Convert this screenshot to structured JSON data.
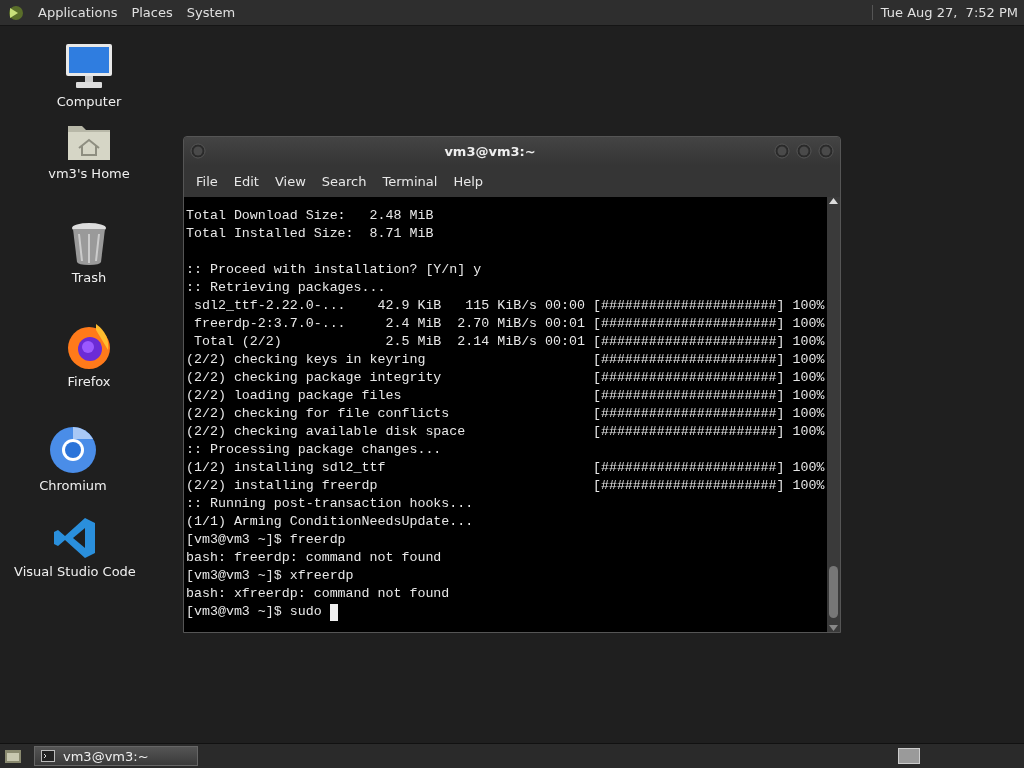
{
  "top_panel": {
    "menus": [
      "Applications",
      "Places",
      "System"
    ],
    "clock": "Tue Aug 27,  7:52 PM"
  },
  "desktop_icons": [
    {
      "label": "Computer",
      "kind": "computer"
    },
    {
      "label": "vm3's Home",
      "kind": "home"
    },
    {
      "label": "Trash",
      "kind": "trash"
    },
    {
      "label": "Firefox",
      "kind": "firefox"
    },
    {
      "label": "Chromium",
      "kind": "chromium"
    },
    {
      "label": "Visual Studio Code",
      "kind": "vscode"
    }
  ],
  "terminal": {
    "title": "vm3@vm3:~",
    "menu": [
      "File",
      "Edit",
      "View",
      "Search",
      "Terminal",
      "Help"
    ],
    "blocks": [
      [
        "Total Download Size:   2.48 MiB",
        "Total Installed Size:  8.71 MiB"
      ],
      [
        ":: Proceed with installation? [Y/n] y",
        ":: Retrieving packages...",
        " sdl2_ttf-2.22.0-...    42.9 KiB   115 KiB/s 00:00 [######################] 100%",
        " freerdp-2:3.7.0-...     2.4 MiB  2.70 MiB/s 00:01 [######################] 100%",
        " Total (2/2)             2.5 MiB  2.14 MiB/s 00:01 [######################] 100%",
        "(2/2) checking keys in keyring                     [######################] 100%",
        "(2/2) checking package integrity                   [######################] 100%",
        "(2/2) loading package files                        [######################] 100%",
        "(2/2) checking for file conflicts                  [######################] 100%",
        "(2/2) checking available disk space                [######################] 100%",
        ":: Processing package changes...",
        "(1/2) installing sdl2_ttf                          [######################] 100%",
        "(2/2) installing freerdp                           [######################] 100%",
        ":: Running post-transaction hooks...",
        "(1/1) Arming ConditionNeedsUpdate...",
        "[vm3@vm3 ~]$ freerdp",
        "bash: freerdp: command not found",
        "[vm3@vm3 ~]$ xfreerdp",
        "bash: xfreerdp: command not found"
      ]
    ],
    "prompt_line": "[vm3@vm3 ~]$ sudo "
  },
  "taskbar": {
    "tasks": [
      {
        "label": "vm3@vm3:~",
        "selected": true
      }
    ]
  }
}
